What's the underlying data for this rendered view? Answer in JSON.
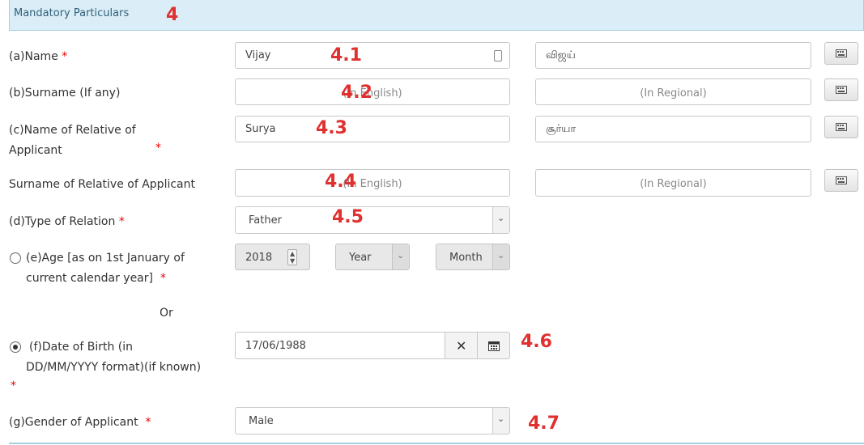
{
  "section": {
    "title": "Mandatory Particulars",
    "annotation": "4"
  },
  "fields": {
    "name": {
      "label": "(a)Name",
      "english_value": "Vijay",
      "regional_value": "விஜய்",
      "annotation": "4.1"
    },
    "surname": {
      "label": "(b)Surname (If any)",
      "english_placeholder": "(In English)",
      "regional_placeholder": "(In Regional)",
      "annotation": "4.2"
    },
    "relative_name": {
      "label_line1": "(c)Name of Relative of",
      "label_line2": "Applicant",
      "english_value": "Surya",
      "regional_value": "சூர்யா",
      "annotation": "4.3"
    },
    "relative_surname": {
      "label": "Surname of Relative of Applicant",
      "english_placeholder": "(In English)",
      "regional_placeholder": "(In Regional)",
      "annotation": "4.4"
    },
    "relation_type": {
      "label": "(d)Type of Relation",
      "selected": "Father",
      "annotation": "4.5"
    },
    "age": {
      "label_line1": "(e)Age [as on 1st January of",
      "label_line2": "current calendar year]",
      "year_value": "2018",
      "year_select": "Year",
      "month_select": "Month"
    },
    "or_text": "Or",
    "dob": {
      "label_line1": "(f)Date of Birth (in",
      "label_line2": "DD/MM/YYYY format)(if known)",
      "value": "17/06/1988",
      "annotation": "4.6"
    },
    "gender": {
      "label": "(g)Gender of Applicant",
      "selected": "Male",
      "annotation": "4.7"
    }
  },
  "required_marker": "*",
  "colors": {
    "header_bg": "#dbeef7",
    "required": "#ee0000",
    "annotation": "#e03030"
  }
}
